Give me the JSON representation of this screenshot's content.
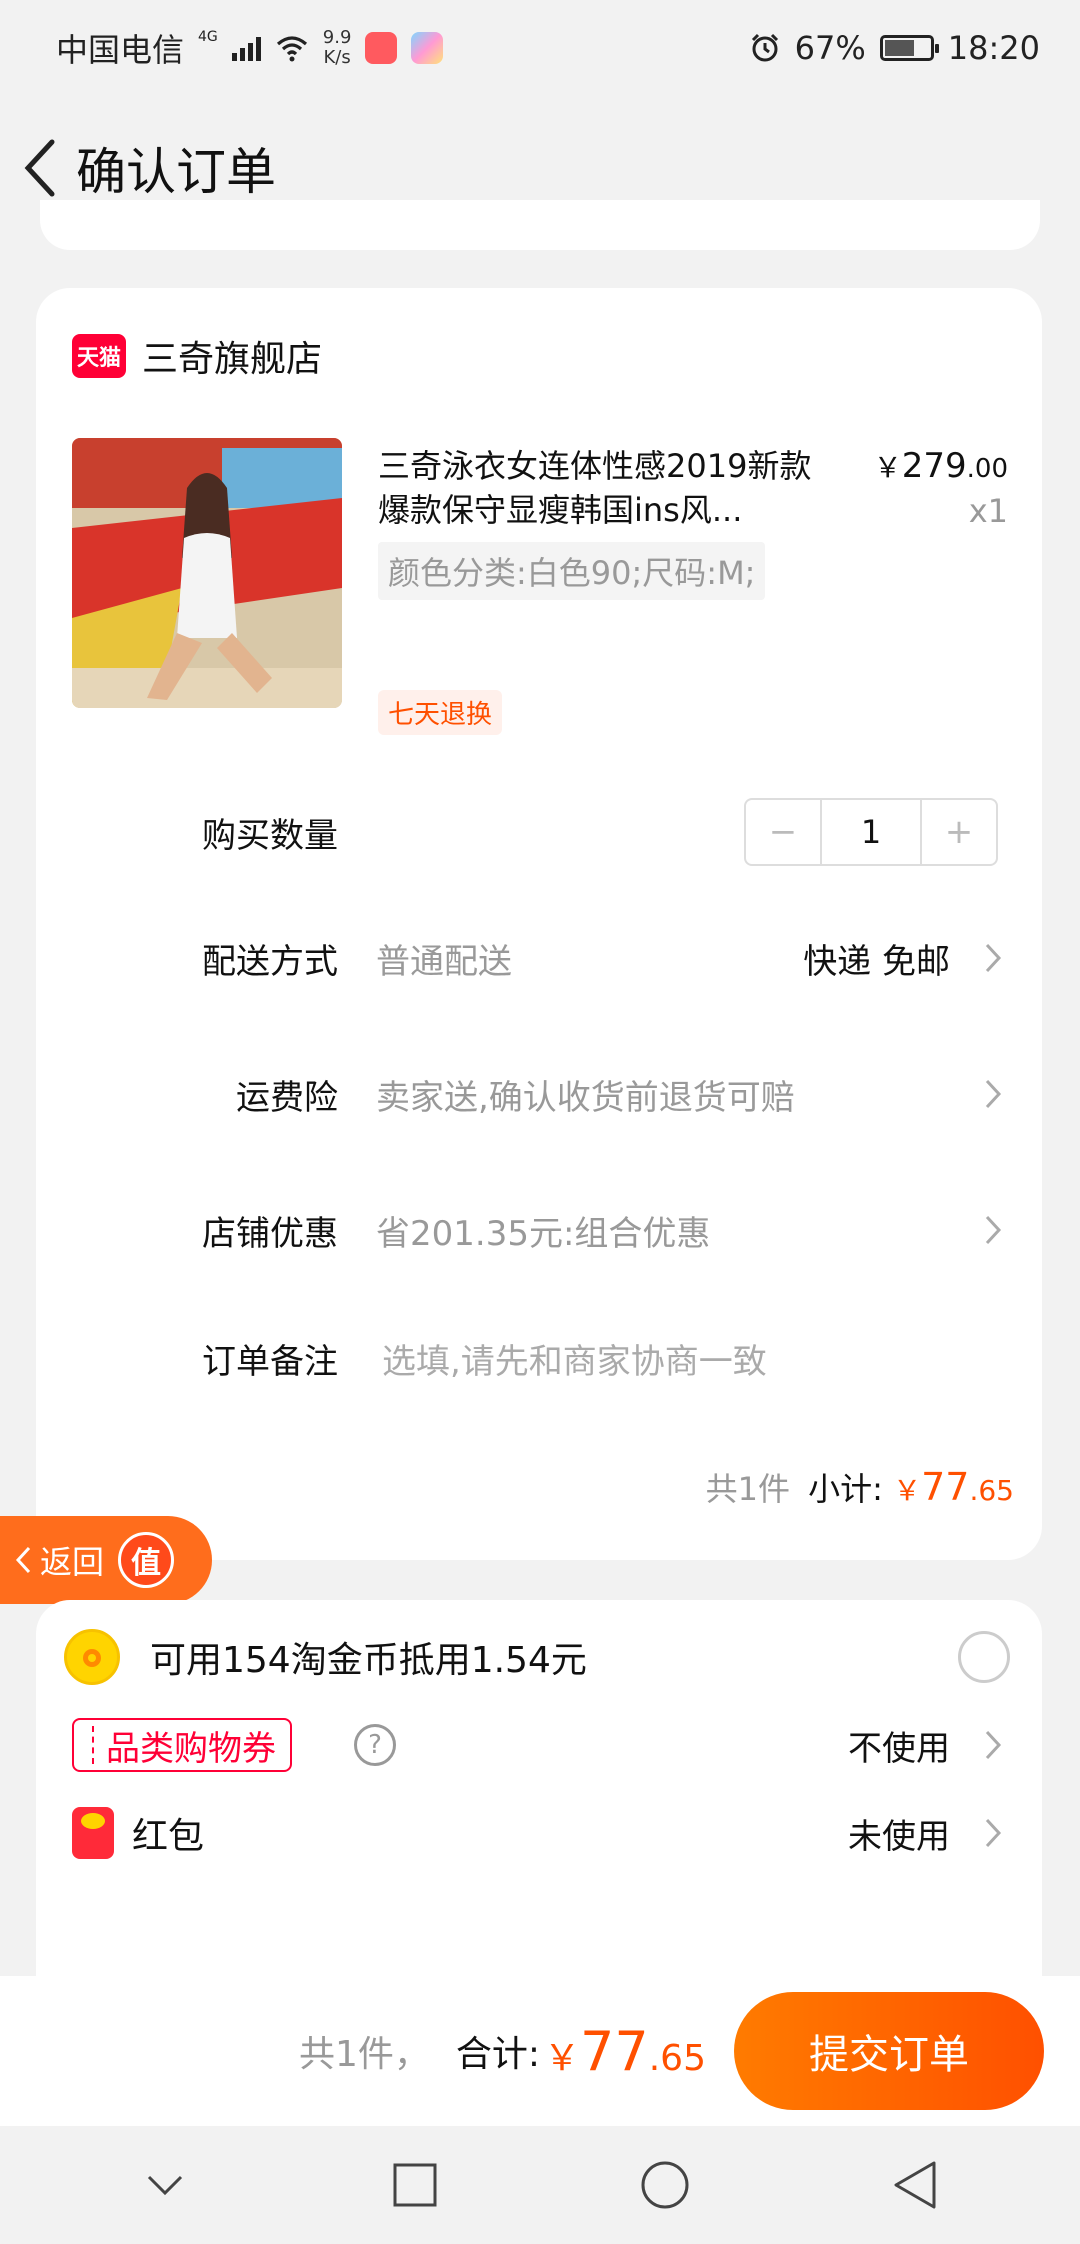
{
  "status_bar": {
    "carrier": "中国电信",
    "network": "4G",
    "speed_value": "9.9",
    "speed_unit": "K/s",
    "battery": "67%",
    "battery_level": 0.67,
    "time": "18:20"
  },
  "header": {
    "title": "确认订单"
  },
  "shop": {
    "badge": "天猫",
    "name": "三奇旗舰店"
  },
  "product": {
    "title": "三奇泳衣女连体性感2019新款爆款保守显瘦韩国ins风...",
    "price_main": "279",
    "price_decimal": ".00",
    "price_currency": "￥",
    "quantity": "x1",
    "sku": "颜色分类:白色90;尺码:M;",
    "return_policy": "七天退换"
  },
  "form": {
    "quantity_label": "购买数量",
    "quantity_value": "1",
    "quantity_minus": "−",
    "quantity_plus": "+",
    "delivery_label": "配送方式",
    "delivery_value": "普通配送",
    "delivery_right": "快递 免邮",
    "insurance_label": "运费险",
    "insurance_value": "卖家送,确认收货前退货可赔",
    "discount_label": "店铺优惠",
    "discount_value": "省201.35元:组合优惠",
    "note_label": "订单备注",
    "note_placeholder": "选填,请先和商家协商一致"
  },
  "subtotal": {
    "count": "共1件",
    "label": "小计:",
    "currency": "￥",
    "amount_main": "77",
    "amount_decimal": ".65"
  },
  "float_button": {
    "label": "返回",
    "value_char": "值"
  },
  "benefits": {
    "coins_text": "可用154淘金币抵用1.54元",
    "coupon_label": "品类购物券",
    "coupon_status": "不使用",
    "help_symbol": "?",
    "redpacket_label": "红包",
    "redpacket_status": "未使用"
  },
  "bottom_bar": {
    "count": "共1件，",
    "total_label": "合计:",
    "currency": "￥",
    "amount_main": "77",
    "amount_decimal": ".65",
    "submit_label": "提交订单"
  },
  "colors": {
    "accent": "#ff5000",
    "tmall_red": "#ff0036",
    "background": "#f2f2f2"
  },
  "icons": {
    "back": "chevron-left-icon",
    "row_arrow": "chevron-right-icon",
    "coin": "coin-icon",
    "help": "help-icon",
    "redpacket": "red-packet-icon",
    "nav": [
      "chevron-down-icon",
      "square-icon",
      "circle-icon",
      "triangle-back-icon"
    ]
  }
}
